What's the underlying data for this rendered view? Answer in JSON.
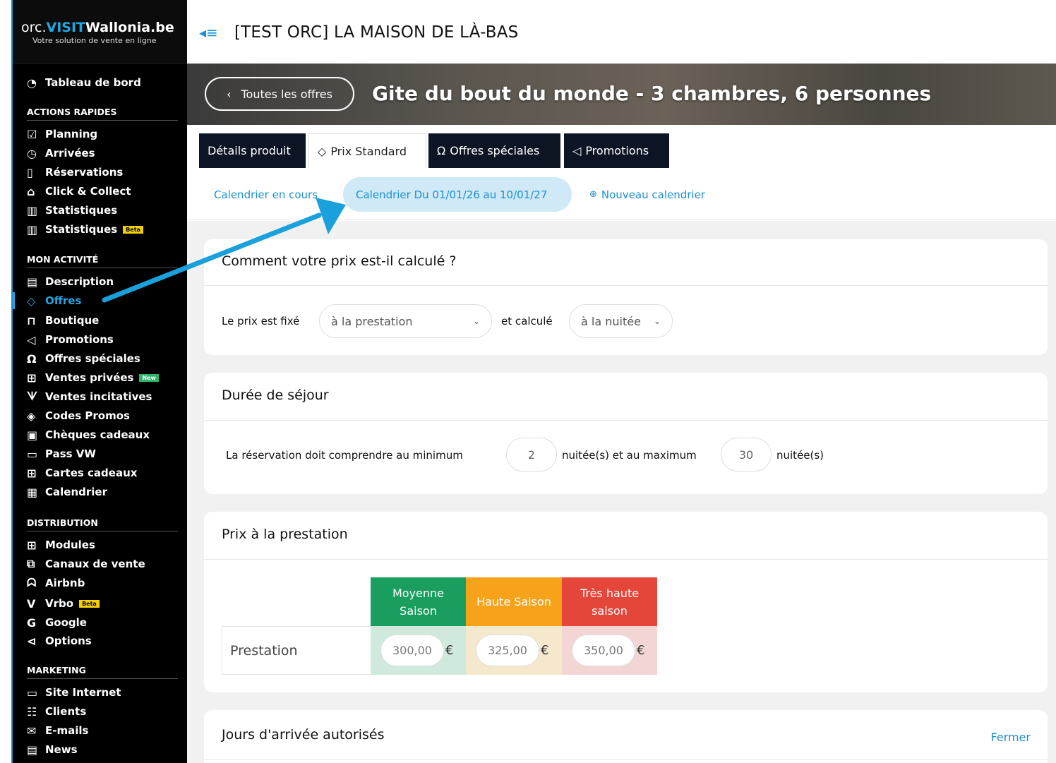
{
  "logo": {
    "part1": "orc.",
    "part2": "VISIT",
    "part3": "Wallonia.be",
    "subtitle": "Votre solution de vente en ligne"
  },
  "topbar": {
    "title": "[TEST ORC] LA MAISON DE LÀ-BAS"
  },
  "banner": {
    "back_label": "Toutes les offres",
    "offer_title": "Gite du bout du monde - 3 chambres, 6 personnes"
  },
  "sidebar": {
    "dashboard": "Tableau de bord",
    "sections": {
      "quick": "ACTIONS RAPIDES",
      "activity": "MON ACTIVITÉ",
      "distribution": "DISTRIBUTION",
      "marketing": "MARKETING"
    },
    "quick_items": [
      "Planning",
      "Arrivées",
      "Réservations",
      "Click & Collect",
      "Statistiques",
      "Statistiques"
    ],
    "activity_items": [
      "Description",
      "Offres",
      "Boutique",
      "Promotions",
      "Offres spéciales",
      "Ventes privées",
      "Ventes incitatives",
      "Codes Promos",
      "Chèques cadeaux",
      "Pass VW",
      "Cartes cadeaux",
      "Calendrier"
    ],
    "distribution_items": [
      "Modules",
      "Canaux de vente",
      "Airbnb",
      "Vrbo",
      "Google",
      "Options"
    ],
    "marketing_items": [
      "Site Internet",
      "Clients",
      "E-mails",
      "News"
    ],
    "badges": {
      "beta": "Beta",
      "new": "New"
    }
  },
  "tabs": [
    "Détails produit",
    "Prix Standard",
    "Offres spéciales",
    "Promotions"
  ],
  "subtabs": {
    "current": "Calendrier en cours",
    "active": "Calendrier Du 01/01/26 au 10/01/27",
    "new": "Nouveau calendrier"
  },
  "pricing_card": {
    "title": "Comment votre prix est-il calculé ?",
    "label_fixed": "Le prix est fixé",
    "select_fixed": "à la prestation",
    "label_calc": "et calculé",
    "select_calc": "à la nuitée"
  },
  "stay_card": {
    "title": "Durée de séjour",
    "text_before": "La réservation doit comprendre au minimum",
    "min": "2",
    "text_middle": "nuitée(s) et au maximum",
    "max": "30",
    "text_after": "nuitée(s)"
  },
  "price_card": {
    "title": "Prix à la prestation",
    "row_label": "Prestation",
    "seasons": [
      {
        "name": "Moyenne Saison",
        "line1": "Moyenne",
        "line2": "Saison",
        "price": "300,00",
        "color": "#1a9e5f",
        "cell_bg": "#cfe9dd"
      },
      {
        "name": "Haute Saison",
        "line1": "Haute Saison",
        "line2": "",
        "price": "325,00",
        "color": "#f7a21b",
        "cell_bg": "#f6e8cd"
      },
      {
        "name": "Très haute saison",
        "line1": "Très haute",
        "line2": "saison",
        "price": "350,00",
        "color": "#e5463a",
        "cell_bg": "#f3d6d3"
      }
    ],
    "currency": "€"
  },
  "days_card": {
    "title": "Jours d'arrivée autorisés",
    "close": "Fermer"
  },
  "colors": {
    "accent": "#1c8fd0",
    "sidebar_bg": "#000000",
    "tab_dark": "#0d1424"
  }
}
